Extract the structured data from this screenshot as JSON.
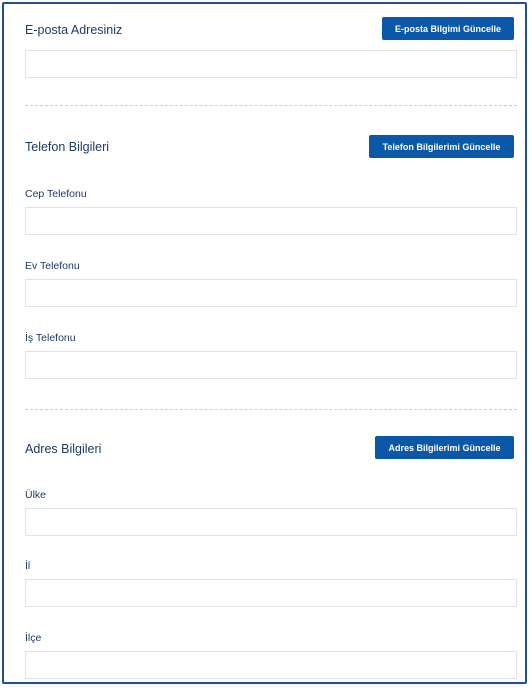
{
  "email": {
    "title": "E-posta Adresiniz",
    "update_button": "E-posta Bilgimi Güncelle",
    "value": ""
  },
  "phone": {
    "title": "Telefon Bilgileri",
    "update_button": "Telefon Bilgilerimi Güncelle",
    "mobile_label": "Cep Telefonu",
    "mobile_value": "",
    "home_label": "Ev Telefonu",
    "home_value": "",
    "work_label": "İş Telefonu",
    "work_value": ""
  },
  "address": {
    "title": "Adres Bilgileri",
    "update_button": "Adres Bilgilerimi Güncelle",
    "country_label": "Ülke",
    "country_value": "",
    "city_label": "İl",
    "city_value": "",
    "district_label": "İlçe",
    "district_value": ""
  },
  "colors": {
    "accent": "#0b57a8",
    "border": "#1f4f8f",
    "text": "#1d3b63"
  }
}
